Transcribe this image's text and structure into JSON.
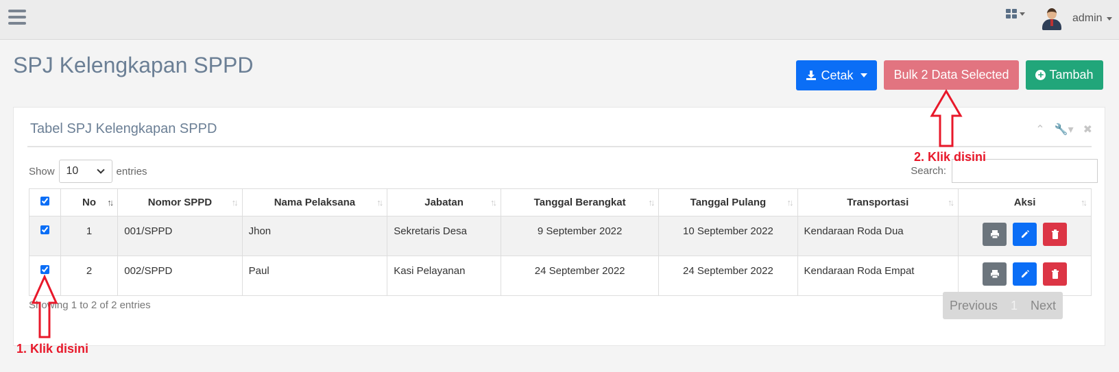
{
  "topbar": {
    "user_name": "admin"
  },
  "page": {
    "title": "SPJ Kelengkapan SPPD"
  },
  "actions": {
    "cetak_label": "Cetak",
    "bulk_label": "Bulk 2 Data Selected",
    "tambah_label": "Tambah"
  },
  "panel": {
    "title": "Tabel SPJ Kelengkapan SPPD"
  },
  "table_controls": {
    "show_label": "Show",
    "entries_value": "10",
    "entries_label": "entries",
    "search_label": "Search:",
    "search_value": ""
  },
  "table": {
    "headers": [
      "No",
      "Nomor SPPD",
      "Nama Pelaksana",
      "Jabatan",
      "Tanggal Berangkat",
      "Tanggal Pulang",
      "Transportasi",
      "Aksi"
    ],
    "rows": [
      {
        "checked": true,
        "no": "1",
        "nomor": "001/SPPD",
        "nama": "Jhon",
        "jabatan": "Sekretaris Desa",
        "berangkat": "9 September 2022",
        "pulang": "10 September 2022",
        "transport": "Kendaraan Roda Dua"
      },
      {
        "checked": true,
        "no": "2",
        "nomor": "002/SPPD",
        "nama": "Paul",
        "jabatan": "Kasi Pelayanan",
        "berangkat": "24 September 2022",
        "pulang": "24 September 2022",
        "transport": "Kendaraan Roda Empat"
      }
    ]
  },
  "footer": {
    "info": "Showing 1 to 2 of 2 entries",
    "previous": "Previous",
    "page": "1",
    "next": "Next"
  },
  "annotations": {
    "step1": "1. Klik disini",
    "step2": "2. Klik disini",
    "color": "#e8182a"
  },
  "colors": {
    "primary": "#0b6ef6",
    "bulk": "#e27480",
    "success": "#21a67a",
    "danger": "#dc3545",
    "secondary": "#6c757d",
    "title": "#6b7f95"
  }
}
